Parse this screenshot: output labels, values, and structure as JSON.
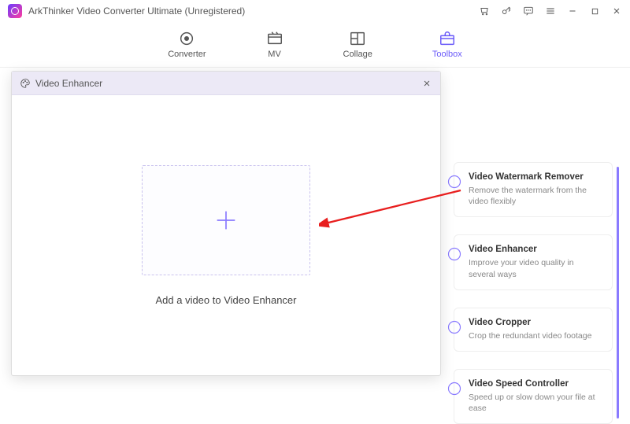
{
  "app": {
    "title": "ArkThinker Video Converter Ultimate (Unregistered)"
  },
  "tabs": {
    "converter": "Converter",
    "mv": "MV",
    "collage": "Collage",
    "toolbox": "Toolbox"
  },
  "tools": {
    "watermark": {
      "title": "Video Watermark Remover",
      "desc": "Remove the watermark from the video flexibly"
    },
    "enhancer": {
      "title": "Video Enhancer",
      "desc": "Improve your video quality in several ways"
    },
    "cropper": {
      "title": "Video Cropper",
      "desc": "Crop the redundant video footage"
    },
    "speed": {
      "title": "Video Speed Controller",
      "desc": "Speed up or slow down your file at ease"
    }
  },
  "dialog": {
    "title": "Video Enhancer",
    "drop_label": "Add a video to Video Enhancer"
  }
}
